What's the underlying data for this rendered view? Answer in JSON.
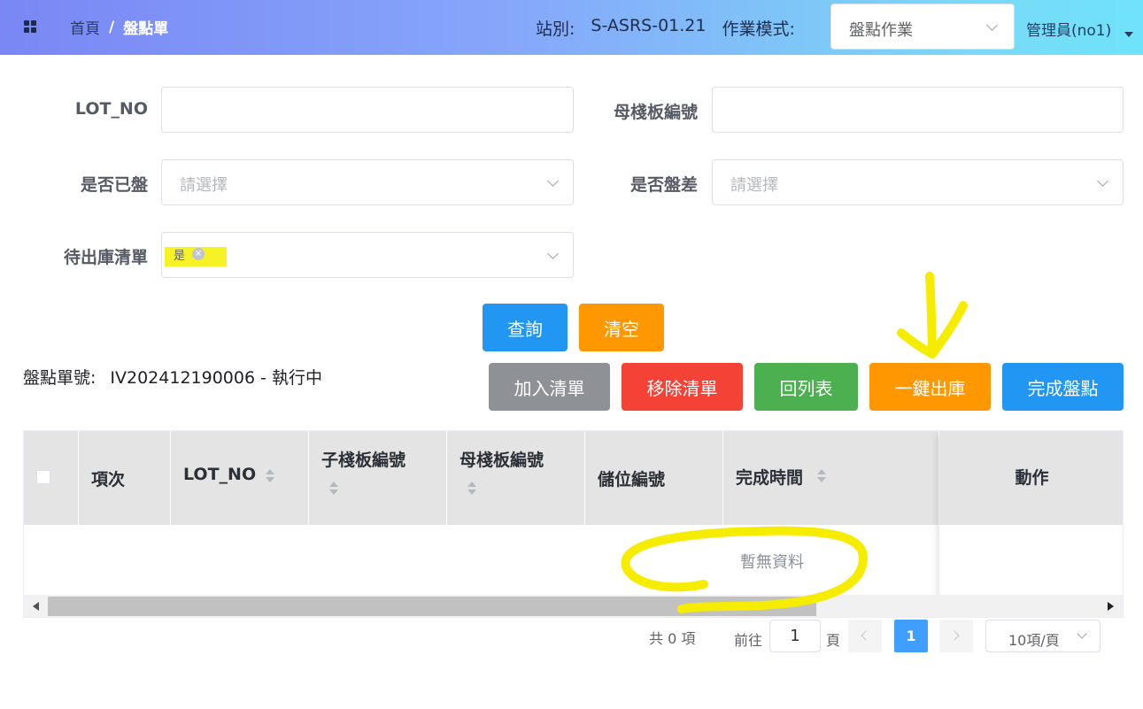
{
  "header": {
    "breadcrumb": [
      "首頁",
      "/",
      "盤點單"
    ],
    "station_label": "站別:",
    "station_value": "S-ASRS-01.21",
    "mode_label": "作業模式:",
    "mode_value": "盤點作業",
    "user": "管理員(no1)"
  },
  "form": {
    "lot_no_label": "LOT_NO",
    "lot_no_value": "",
    "mother_board_label": "母棧板編號",
    "mother_board_value": "",
    "counted_label": "是否已盤",
    "counted_placeholder": "請選擇",
    "diff_label": "是否盤差",
    "diff_placeholder": "請選擇",
    "pending_label": "待出庫清單",
    "pending_tag": "是"
  },
  "buttons": {
    "query": "查詢",
    "clear": "清空",
    "add_list": "加入清單",
    "remove_list": "移除清單",
    "back_list": "回列表",
    "one_click_out": "一鍵出庫",
    "complete": "完成盤點"
  },
  "order": {
    "label": "盤點單號:",
    "value": "IV202412190006 - 執行中"
  },
  "table": {
    "columns": [
      "項次",
      "LOT_NO",
      "子棧板編號",
      "母棧板編號",
      "儲位編號",
      "完成時間",
      "動作"
    ],
    "rows": [],
    "empty_text": "暫無資料"
  },
  "pagination": {
    "total": "共 0 項",
    "goto_label": "前往",
    "goto_value": "1",
    "page_unit": "頁",
    "current_page": "1",
    "page_size": "10項/頁"
  },
  "colors": {
    "highlight": "#f5f000",
    "primary": "#2196f3",
    "warning": "#ff9800",
    "danger": "#f44336",
    "success": "#4caf50",
    "info": "#8e9196"
  }
}
